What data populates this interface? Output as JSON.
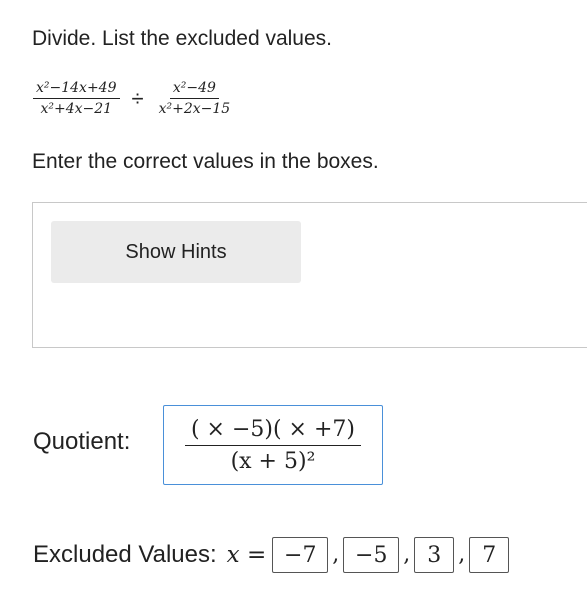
{
  "title": "Divide. List the excluded values.",
  "problem": {
    "fraction1": {
      "numerator": "x²−14x+49",
      "denominator": "x²+4x−21"
    },
    "operator": "÷",
    "fraction2": {
      "numerator": "x²−49",
      "denominator": "x²+2x−15"
    }
  },
  "instructions": "Enter the correct values in the boxes.",
  "hint_button": "Show Hints",
  "quotient": {
    "label": "Quotient:",
    "numerator": "( × −5)( × +7)",
    "denominator": "(x + 5)²"
  },
  "excluded": {
    "label": "Excluded Values:",
    "variable": "x",
    "equals": "=",
    "values": [
      "−7",
      "−5",
      "3",
      "7"
    ],
    "separator": ","
  },
  "colors": {
    "input_focus_border": "#4a90d9",
    "hint_button_bg": "#ebebeb"
  }
}
